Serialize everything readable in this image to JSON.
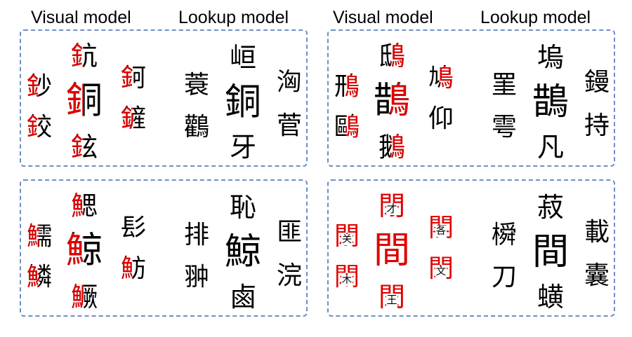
{
  "headers": {
    "visual_left": "Visual model",
    "lookup_left": "Lookup model",
    "visual_right": "Visual model",
    "lookup_right": "Lookup model"
  },
  "colors": {
    "highlight": "#e00000",
    "text": "#000000",
    "panel_border": "#6c8fc6"
  },
  "panels": {
    "top_left": {
      "visual": [
        {
          "char": "鈔",
          "red_part": "left"
        },
        {
          "char": "鉸",
          "red_part": "left"
        },
        {
          "char": "鈧",
          "red_part": "left"
        },
        {
          "char": "銅",
          "red_part": "left"
        },
        {
          "char": "鉉",
          "red_part": "left"
        },
        {
          "char": "鈳",
          "red_part": "left"
        },
        {
          "char": "鏟",
          "red_part": "left"
        }
      ],
      "lookup": [
        "蓑",
        "鸛",
        "峘",
        "銅",
        "牙",
        "洶",
        "菅"
      ]
    },
    "top_right": {
      "visual": [
        {
          "char": "鳽",
          "red_part": "right"
        },
        {
          "char": "鷗",
          "red_part": "right"
        },
        {
          "char": "鴟",
          "red_part": "right"
        },
        {
          "char": "鵲",
          "red_part": "right"
        },
        {
          "char": "鵝",
          "red_part": "right"
        },
        {
          "char": "鳩",
          "red_part": "right"
        },
        {
          "char": "仰",
          "red_part": "none"
        }
      ],
      "lookup": [
        "罣",
        "雩",
        "塢",
        "鵲",
        "凡",
        "鏝",
        "持"
      ]
    },
    "bottom_left": {
      "visual": [
        {
          "char": "鱬",
          "red_part": "left"
        },
        {
          "char": "鱗",
          "red_part": "left"
        },
        {
          "char": "鰓",
          "red_part": "left"
        },
        {
          "char": "鯨",
          "red_part": "left"
        },
        {
          "char": "鱖",
          "red_part": "left"
        },
        {
          "char": "髟",
          "red_part": "none"
        },
        {
          "char": "魴",
          "red_part": "left"
        }
      ],
      "lookup": [
        "排",
        "翀",
        "恥",
        "鯨",
        "鹵",
        "匪",
        "浣"
      ]
    },
    "bottom_right": {
      "visual": [
        {
          "char": "閖",
          "red_part": "frame",
          "inner": "关"
        },
        {
          "char": "閑",
          "red_part": "frame",
          "inner": "木"
        },
        {
          "char": "閉",
          "red_part": "frame",
          "inner": "才"
        },
        {
          "char": "間",
          "red_part": "all",
          "inner": ""
        },
        {
          "char": "閏",
          "red_part": "frame",
          "inner": "王"
        },
        {
          "char": "閣",
          "red_part": "frame",
          "inner": "各"
        },
        {
          "char": "閔",
          "red_part": "frame",
          "inner": "文"
        }
      ],
      "lookup": [
        "橓",
        "刀",
        "菽",
        "間",
        "蟥",
        "載",
        "囊"
      ]
    }
  }
}
